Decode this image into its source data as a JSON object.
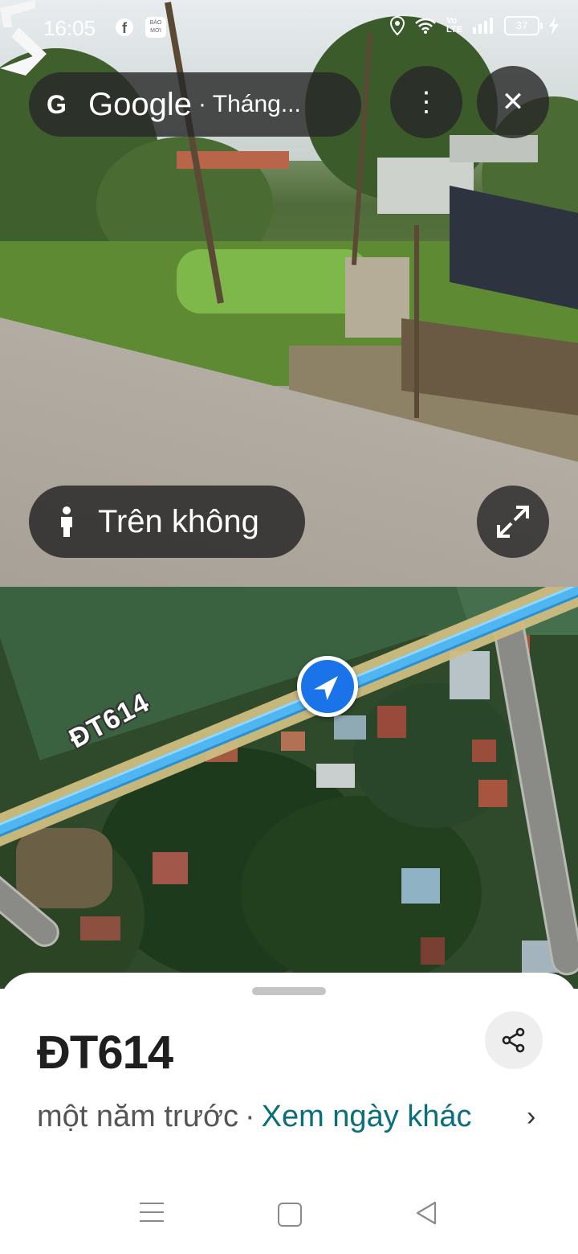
{
  "status_bar": {
    "time": "16:05",
    "fb_icon": "facebook-icon",
    "baomoi_text": "BÁO MỚI",
    "battery": "37"
  },
  "top_bar": {
    "logo": "G",
    "title": "Google",
    "subtitle": "· Tháng...",
    "more_icon": "⋮",
    "close_icon": "✕"
  },
  "streetview": {
    "aerial_label": "Trên không",
    "expand_icon": "expand-icon"
  },
  "map": {
    "road_label": "ĐT614"
  },
  "sheet": {
    "title": "ĐT614",
    "date_text": "một năm trước",
    "separator": "·",
    "link_text": "Xem ngày khác",
    "chevron": "›"
  },
  "colors": {
    "marker_blue": "#1a73e8",
    "road_blue": "#4fb6f2",
    "link_teal": "#0b6e7b"
  }
}
